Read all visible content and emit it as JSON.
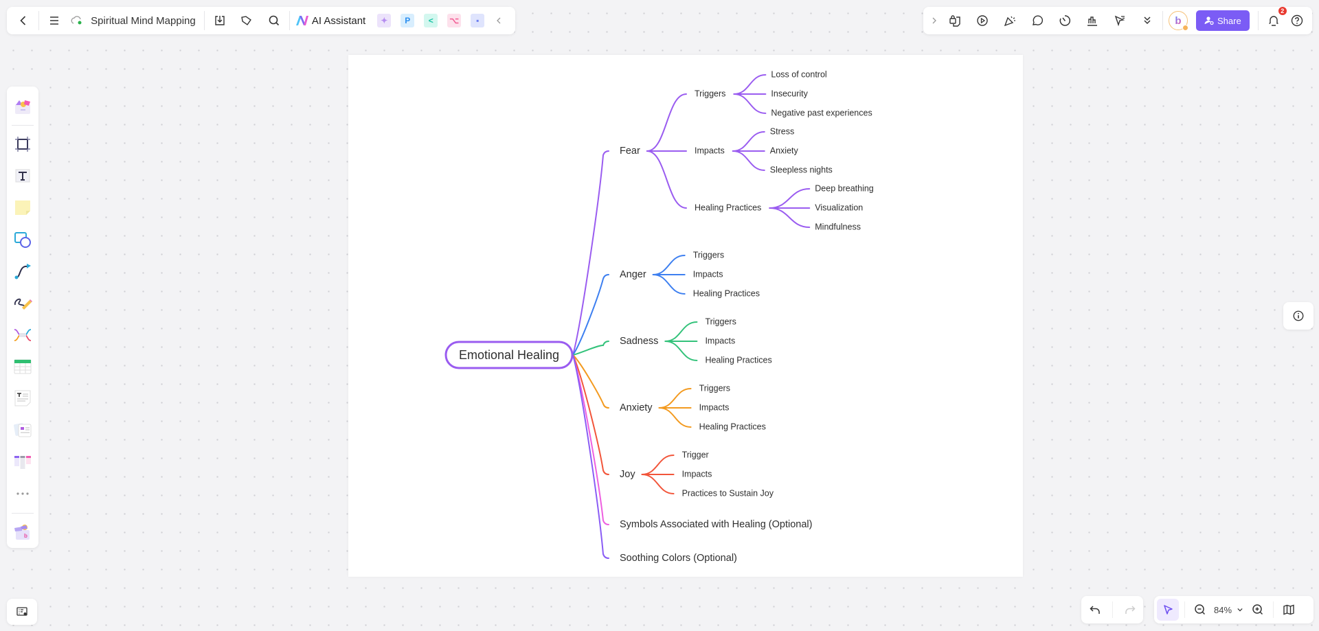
{
  "toolbar_left": {
    "back_icon": "chevron-left-icon",
    "menu_icon": "hamburger-menu-icon",
    "sync_icon": "cloud-synced-icon",
    "document_title": "Spiritual Mind Mapping",
    "download_icon": "download-icon",
    "tag_icon": "tag-icon",
    "search_icon": "search-icon",
    "ai_assistant_label": "AI Assistant",
    "apps": [
      {
        "name": "ai-image-app",
        "glyph": "✦",
        "bg": "#ece3fb",
        "fg": "#b58cf0"
      },
      {
        "name": "presentation-app",
        "glyph": "P",
        "bg": "#d8eefe",
        "fg": "#2b8ef0"
      },
      {
        "name": "mindmap-app",
        "glyph": "<",
        "bg": "#d3f7ef",
        "fg": "#19c3a4"
      },
      {
        "name": "flowchart-app",
        "glyph": "⌥",
        "bg": "#fde1ec",
        "fg": "#f25b93"
      },
      {
        "name": "chat-app",
        "glyph": "▪",
        "bg": "#dfe4fd",
        "fg": "#6b7ef0"
      }
    ],
    "collapse_icon": "chevron-left-icon"
  },
  "toolbar_right": {
    "expand_icon": "chevron-right-icon",
    "tools": [
      "lock-page-icon",
      "play-presentation-icon",
      "celebrate-icon",
      "comment-icon",
      "timer-icon",
      "chart-icon",
      "cursor-filter-icon",
      "more-chevrons-icon"
    ],
    "share_label": "Share",
    "notification_count": "2",
    "help_icon": "help-icon"
  },
  "left_tools": [
    "templates-icon",
    "frame-icon",
    "text-icon",
    "sticky-note-icon",
    "shapes-icon",
    "connector-icon",
    "pen-icon",
    "mindmap-icon",
    "table-icon",
    "text-document-icon",
    "cards-icon",
    "kanban-icon",
    "more-icon",
    "apps-box-icon"
  ],
  "mindmap": {
    "root": "Emotional Healing",
    "colors": {
      "root_border": "#9a5cf0",
      "fear": "#9a5cf0",
      "anger": "#3d7ff0",
      "sadness": "#33c27a",
      "anxiety": "#f39a1f",
      "joy": "#f2553a",
      "symbols": "#ee5fe0",
      "soothing": "#8a5cf5"
    },
    "branches": [
      {
        "label": "Fear",
        "children": [
          {
            "label": "Triggers",
            "children": [
              "Loss of control",
              "Insecurity",
              "Negative past experiences"
            ]
          },
          {
            "label": "Impacts",
            "children": [
              "Stress",
              "Anxiety",
              "Sleepless nights"
            ]
          },
          {
            "label": "Healing Practices",
            "children": [
              "Deep breathing",
              "Visualization",
              "Mindfulness"
            ]
          }
        ]
      },
      {
        "label": "Anger",
        "children": [
          {
            "label": "Triggers"
          },
          {
            "label": "Impacts"
          },
          {
            "label": "Healing Practices"
          }
        ]
      },
      {
        "label": "Sadness",
        "children": [
          {
            "label": "Triggers"
          },
          {
            "label": "Impacts"
          },
          {
            "label": "Healing Practices"
          }
        ]
      },
      {
        "label": "Anxiety",
        "children": [
          {
            "label": "Triggers"
          },
          {
            "label": "Impacts"
          },
          {
            "label": "Healing Practices"
          }
        ]
      },
      {
        "label": "Joy",
        "children": [
          {
            "label": "Trigger"
          },
          {
            "label": "Impacts"
          },
          {
            "label": "Practices to Sustain Joy"
          }
        ]
      },
      {
        "label": "Symbols Associated with Healing (Optional)",
        "children": []
      },
      {
        "label": "Soothing Colors (Optional)",
        "children": []
      }
    ]
  },
  "bottom": {
    "zoom_level": "84%",
    "undo_icon": "undo-icon",
    "redo_icon": "redo-icon",
    "select_icon": "select-pointer-icon",
    "zoom_out_icon": "zoom-out-icon",
    "zoom_in_icon": "zoom-in-icon",
    "map_icon": "minimap-icon",
    "outline_icon": "outline-view-icon",
    "info_icon": "info-icon"
  }
}
